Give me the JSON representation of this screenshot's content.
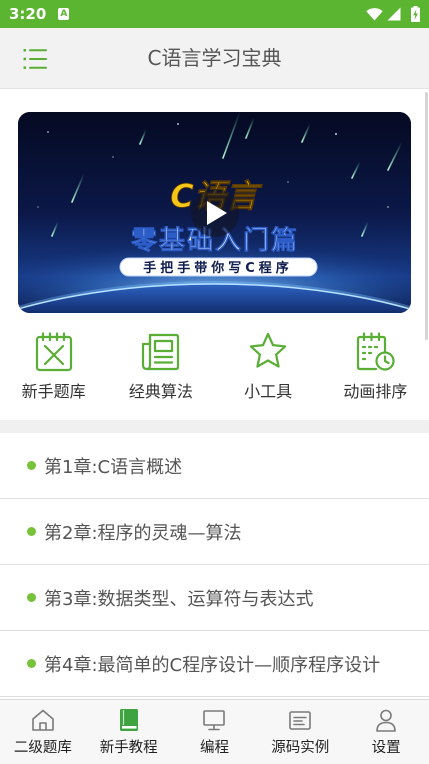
{
  "colors": {
    "status_bar": "#5cb531",
    "accent": "#5aad35",
    "bullet": "#76c33a",
    "app_bar_bg": "#f2f2f2",
    "title_text": "#555555",
    "list_text": "#555555",
    "nav_active_icon": "#3fa43f",
    "nav_icon": "#7a7a7a",
    "banner_logo": "#f5c518"
  },
  "status_bar": {
    "time": "3:20",
    "notification_glyph": "A",
    "notification_icon": "app-notification-icon",
    "right_icons": [
      "wifi-icon",
      "signal-icon",
      "battery-charging-icon"
    ]
  },
  "app_bar": {
    "menu_icon": "list-icon",
    "title": "C语言学习宝典"
  },
  "banner": {
    "logo_text": "C语言",
    "headline": "零基础入门篇",
    "tagline": "手把手带你写C程序",
    "play_icon": "play-icon"
  },
  "quick_actions": [
    {
      "label": "新手题库",
      "icon": "quiz-icon"
    },
    {
      "label": "经典算法",
      "icon": "newspaper-icon"
    },
    {
      "label": "小工具",
      "icon": "star-icon"
    },
    {
      "label": "动画排序",
      "icon": "calendar-clock-icon"
    }
  ],
  "chapters": [
    {
      "title": "第1章:C语言概述"
    },
    {
      "title": "第2章:程序的灵魂—算法"
    },
    {
      "title": "第3章:数据类型、运算符与表达式"
    },
    {
      "title": "第4章:最简单的C程序设计—顺序程序设计"
    }
  ],
  "bottom_nav": {
    "active_index": 1,
    "items": [
      {
        "label": "二级题库",
        "icon": "home-icon"
      },
      {
        "label": "新手教程",
        "icon": "book-icon"
      },
      {
        "label": "编程",
        "icon": "monitor-icon"
      },
      {
        "label": "源码实例",
        "icon": "code-window-icon"
      },
      {
        "label": "设置",
        "icon": "user-icon"
      }
    ]
  }
}
